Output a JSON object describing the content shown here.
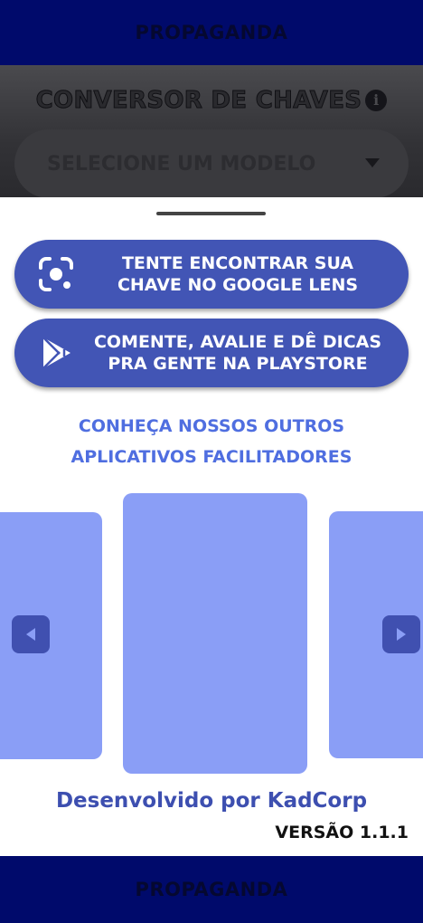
{
  "ads": {
    "top_label": "PROPAGANDA",
    "bottom_label": "PROPAGANDA"
  },
  "header": {
    "title": "CONVERSOR DE CHAVES",
    "info_icon": "info-icon"
  },
  "model_select": {
    "placeholder": "SELECIONE UM MODELO",
    "icon": "chevron-down-icon"
  },
  "sheet": {
    "lens_button": {
      "line1": "TENTE ENCONTRAR SUA",
      "line2": "CHAVE NO GOOGLE LENS",
      "icon": "google-lens-icon"
    },
    "store_button": {
      "line1": "COMENTE, AVALIE E DÊ DICAS",
      "line2": "PRA GENTE NA PLAYSTORE",
      "icon": "play-store-icon"
    },
    "apps_heading": {
      "line1": "CONHEÇA NOSSOS OUTROS",
      "line2": "APLICATIVOS FACILITADORES"
    },
    "credits": "Desenvolvido por KadCorp",
    "version": "VERSÃO 1.1.1"
  },
  "colors": {
    "ad_bar": "#000a6b",
    "button": "#4255b5",
    "heading": "#4f6ee0",
    "card": "#8a9ef6",
    "arrow": "#4050b0"
  }
}
